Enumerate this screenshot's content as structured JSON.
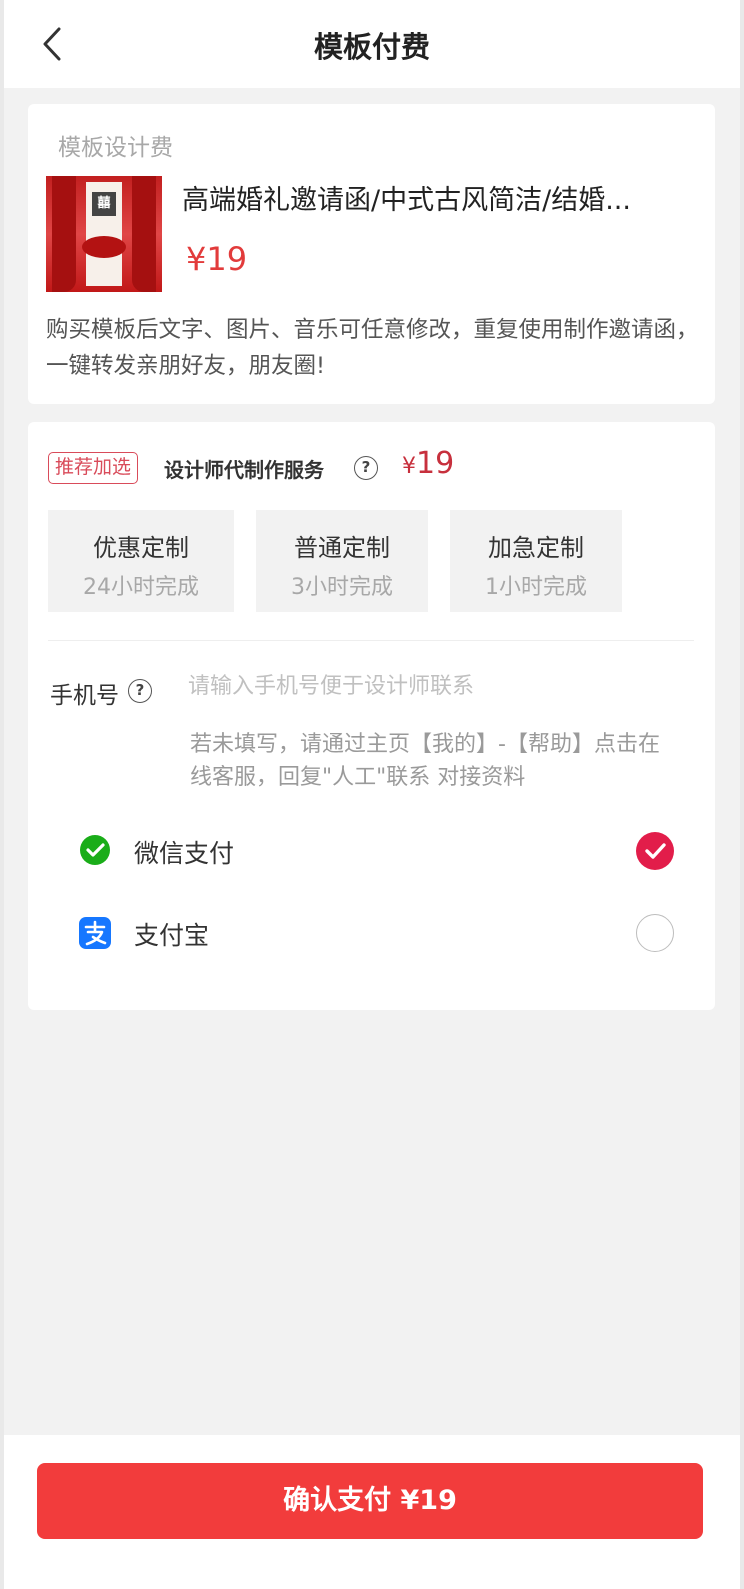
{
  "header": {
    "title": "模板付费",
    "back_icon": "chevron-left-icon"
  },
  "template": {
    "section_label": "模板设计费",
    "title": "高端婚礼邀请函/中式古风简洁/结婚...",
    "price": "¥19",
    "thumb_seal": "囍",
    "description": "购买模板后文字、图片、音乐可任意修改，重复使用制作邀请函，一键转发亲朋好友，朋友圈!"
  },
  "service": {
    "badge": "推荐加选",
    "name": "设计师代制作服务",
    "help_icon_glyph": "?",
    "price_symbol": "¥",
    "price_value": "19",
    "options": [
      {
        "title": "优惠定制",
        "subtitle": "24小时完成"
      },
      {
        "title": "普通定制",
        "subtitle": "3小时完成"
      },
      {
        "title": "加急定制",
        "subtitle": "1小时完成"
      }
    ]
  },
  "phone": {
    "label": "手机号",
    "help_icon_glyph": "?",
    "placeholder": "请输入手机号便于设计师联系",
    "note": "若未填写，请通过主页【我的】-【帮助】点击在线客服，回复\"人工\"联系 对接资料"
  },
  "payment": {
    "methods": [
      {
        "label": "微信支付",
        "icon": "wechat-pay-icon",
        "selected": true
      },
      {
        "label": "支付宝",
        "icon": "alipay-icon",
        "selected": false
      }
    ]
  },
  "footer": {
    "confirm_label": "确认支付 ¥19"
  },
  "colors": {
    "accent_red": "#f23c3c",
    "price_red": "#e23b3b",
    "check_red": "#e21d4a",
    "wechat_green": "#1aad19",
    "alipay_blue": "#1677ff"
  }
}
